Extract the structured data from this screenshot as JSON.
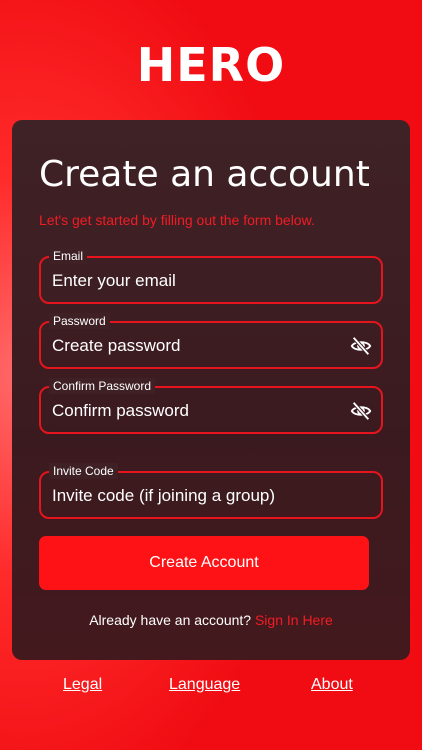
{
  "app": {
    "logo": "HERO"
  },
  "form": {
    "title": "Create an account",
    "subtitle": "Let's get started by filling out the form below.",
    "email": {
      "label": "Email",
      "placeholder": "Enter your email"
    },
    "password": {
      "label": "Password",
      "placeholder": "Create password",
      "icon": "eye-off-icon"
    },
    "confirm": {
      "label": "Confirm Password",
      "placeholder": "Confirm password",
      "icon": "eye-off-icon"
    },
    "invite": {
      "label": "Invite Code",
      "placeholder": "Invite code (if joining a group)"
    },
    "submit_label": "Create Account",
    "signin_prompt": "Already have an account?",
    "signin_link": "Sign In Here"
  },
  "footer": {
    "legal": "Legal",
    "language": "Language",
    "about": "About"
  },
  "colors": {
    "accent": "#ff1216",
    "card": "#3e2025",
    "text": "#ffffff"
  }
}
